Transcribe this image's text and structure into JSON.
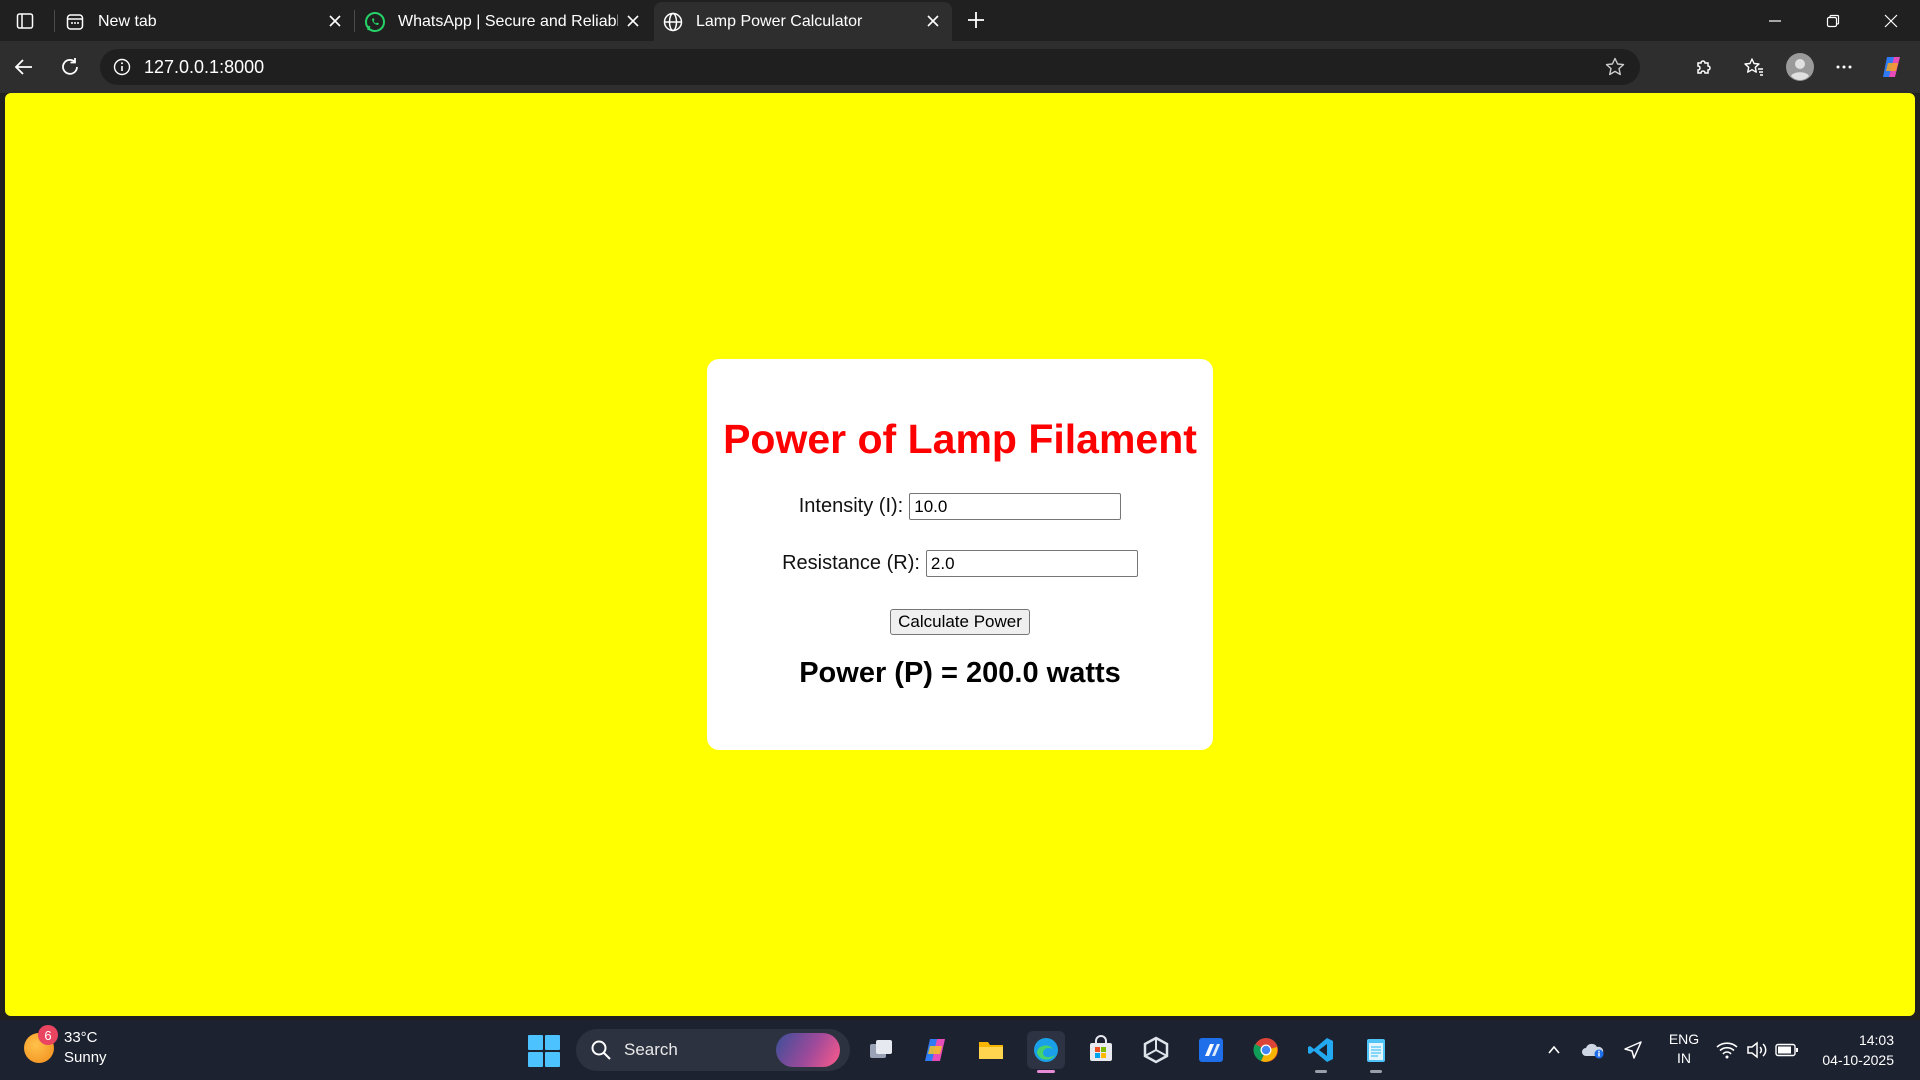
{
  "browser": {
    "tabs": [
      {
        "label": "New tab"
      },
      {
        "label": "WhatsApp | Secure and Reliable Free Private Messaging and Calling"
      },
      {
        "label": "Lamp Power Calculator"
      }
    ],
    "address": {
      "url": "127.0.0.1:8000"
    }
  },
  "page": {
    "title": "Power of Lamp Filament",
    "intensity_label": "Intensity (I):",
    "intensity_value": "10.0",
    "resistance_label": "Resistance (R):",
    "resistance_value": "2.0",
    "button_label": "Calculate Power",
    "result": "Power (P) = 200.0 watts",
    "background_color": "#ffff00",
    "title_color": "#ff0000"
  },
  "taskbar": {
    "weather": {
      "temp": "33°C",
      "condition": "Sunny",
      "badge": "6"
    },
    "search_label": "Search",
    "language": {
      "line1": "ENG",
      "line2": "IN"
    },
    "clock": {
      "time": "14:03",
      "date": "04-10-2025"
    },
    "apps": [
      "task-view",
      "copilot",
      "file-explorer",
      "edge",
      "microsoft-store",
      "unity",
      "vs-code-insiders",
      "chrome",
      "vscode",
      "notepad"
    ]
  }
}
